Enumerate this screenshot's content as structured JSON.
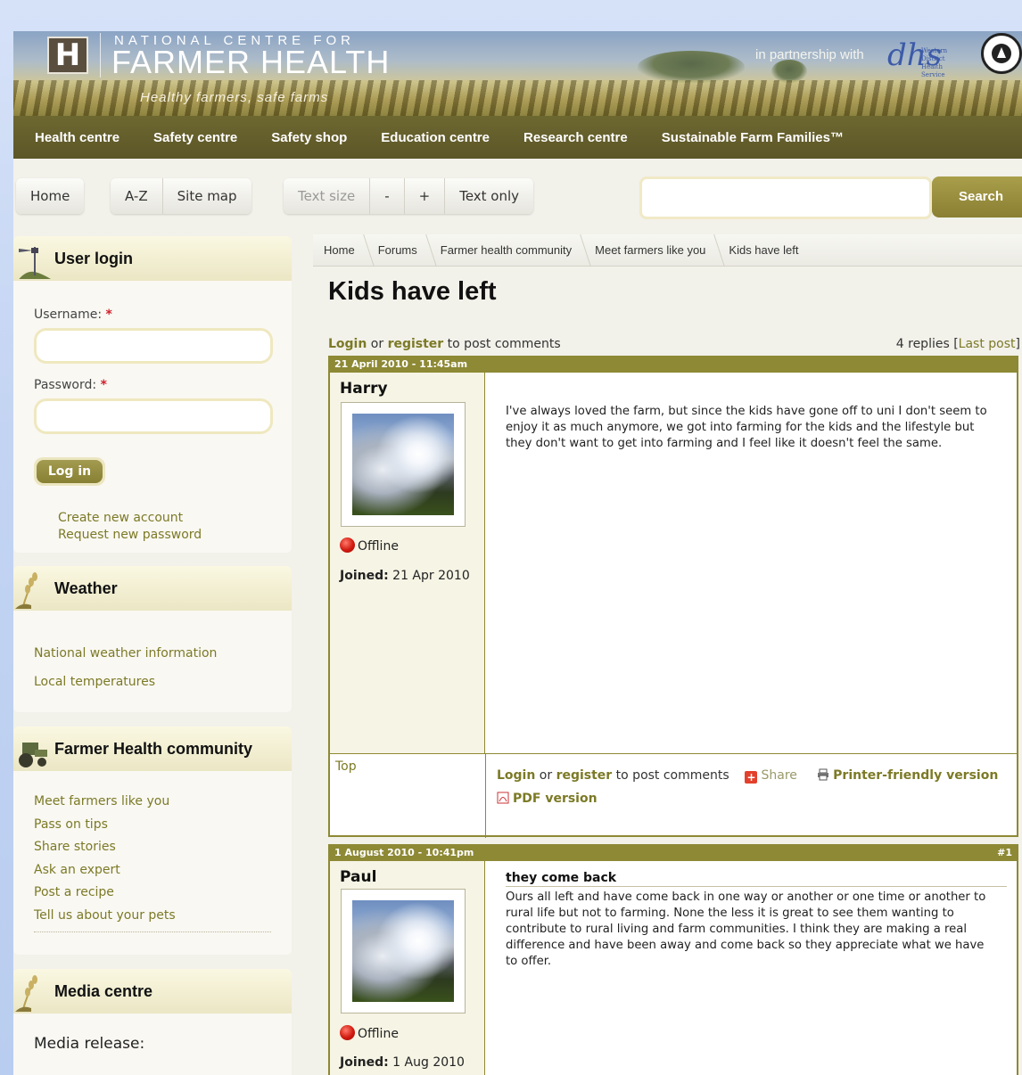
{
  "header": {
    "logo_mark": "H",
    "logo_top": "NATIONAL CENTRE FOR",
    "logo_main": "FARMER HEALTH",
    "tagline": "Healthy farmers, safe farms",
    "partner_text": "in partnership with",
    "partner_logo": "dhs",
    "partner_small": "Western District Health Service"
  },
  "nav": [
    "Health centre",
    "Safety centre",
    "Safety shop",
    "Education centre",
    "Research centre",
    "Sustainable Farm Families™"
  ],
  "toolbar": {
    "home": "Home",
    "az": "A-Z",
    "sitemap": "Site map",
    "textsize": "Text size",
    "minus": "-",
    "plus": "+",
    "textonly": "Text only",
    "search_value": "",
    "search_button": "Search"
  },
  "login": {
    "title": "User login",
    "username_label": "Username:",
    "password_label": "Password:",
    "required": "*",
    "button": "Log in",
    "create": "Create new account",
    "request": "Request new password"
  },
  "weather": {
    "title": "Weather",
    "links": [
      "National weather information",
      "Local temperatures"
    ]
  },
  "community": {
    "title": "Farmer Health community",
    "links": [
      "Meet farmers like you",
      "Pass on tips",
      "Share stories",
      "Ask an expert",
      "Post a recipe",
      "Tell us about your pets"
    ]
  },
  "media": {
    "title": "Media centre",
    "release_label": "Media release:"
  },
  "breadcrumb": [
    "Home",
    "Forums",
    "Farmer health community",
    "Meet farmers like you",
    "Kids have left"
  ],
  "page_title": "Kids have left",
  "meta": {
    "login": "Login",
    "or": "or",
    "register": "register",
    "to_post": "to post comments",
    "replies": "4 replies [",
    "last_post": "Last post",
    "close_bracket": "]"
  },
  "posts": [
    {
      "date": "21 April 2010 - 11:45am",
      "number": "",
      "author": "Harry",
      "status": "Offline",
      "joined_label": "Joined:",
      "joined": "21 Apr 2010",
      "subject": "",
      "body": "I've always loved the farm, but since the kids have gone off to uni I don't seem to enjoy it as much anymore, we got into farming for the kids and the lifestyle but they don't want to get into farming and I feel like it doesn't feel the same."
    },
    {
      "date": "1 August 2010 - 10:41pm",
      "number": "#1",
      "author": "Paul",
      "status": "Offline",
      "joined_label": "Joined:",
      "joined": "1 Aug 2010",
      "subject": "they come back",
      "body": "Ours all left and have come back in one way or another or one time or another to rural life but not to farming. None the less it is great to see them wanting to contribute to rural living and farm communities. I think they are making a real difference and have been away and come back so they appreciate what we have to offer."
    }
  ],
  "post_footer": {
    "top": "Top",
    "login": "Login",
    "or": "or",
    "register": "register",
    "to_post": "to post comments",
    "share": "Share",
    "printer": "Printer-friendly version",
    "pdf": "PDF version"
  },
  "colors": {
    "olive": "#8d8935",
    "olive_text": "#7c7a26",
    "nav_bg": "#5c5628",
    "required": "#d0202a",
    "offline": "#d11a10"
  }
}
